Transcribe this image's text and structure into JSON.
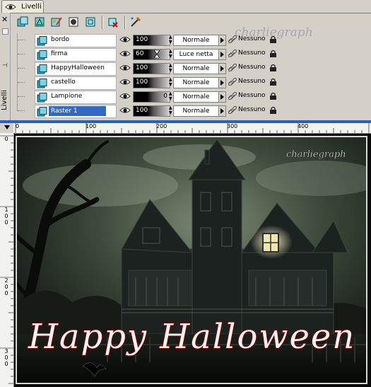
{
  "palette": {
    "tab_label": "Livelli",
    "side_label": "Livelli",
    "close_glyph": "✕",
    "toolbar_buttons": [
      "new-raster-layer-icon",
      "new-vector-layer-icon",
      "new-art-media-layer-icon",
      "new-mask-layer-icon",
      "new-adjustment-layer-icon",
      "delete-layer-icon",
      "edit-selection-icon"
    ]
  },
  "layers": [
    {
      "name": "bordo",
      "opacity": "100",
      "opacity_frac": 1.0,
      "blend": "Normale",
      "group": "Nessuno",
      "selected": false
    },
    {
      "name": "firma",
      "opacity": "60",
      "opacity_frac": 0.6,
      "blend": "Luce netta",
      "group": "Nessuno",
      "selected": false
    },
    {
      "name": "HappyHalloween",
      "opacity": "100",
      "opacity_frac": 1.0,
      "blend": "Normale",
      "group": "Nessuno",
      "selected": false
    },
    {
      "name": "castello",
      "opacity": "100",
      "opacity_frac": 1.0,
      "blend": "Normale",
      "group": "Nessuno",
      "selected": false
    },
    {
      "name": "Lampione",
      "opacity": "0",
      "opacity_frac": 0.0,
      "blend": "Normale",
      "group": "Nessuno",
      "selected": false
    },
    {
      "name": "Raster 1",
      "opacity": "100",
      "opacity_frac": 1.0,
      "blend": "Normale",
      "group": "Nessuno",
      "selected": true
    }
  ],
  "watermark_palette": "charliegraph",
  "canvas": {
    "ruler_h_labels": [
      "0",
      "100",
      "200",
      "300",
      "400"
    ],
    "ruler_v_labels": [
      "0",
      "100",
      "200",
      "300"
    ],
    "image_text": "Happy Halloween",
    "image_signature": "charliegraph",
    "colors": {
      "frame": "#2a5fc2",
      "sky": "#4a5a44",
      "house": "#1c2220",
      "window": "#f2e6b0"
    }
  }
}
